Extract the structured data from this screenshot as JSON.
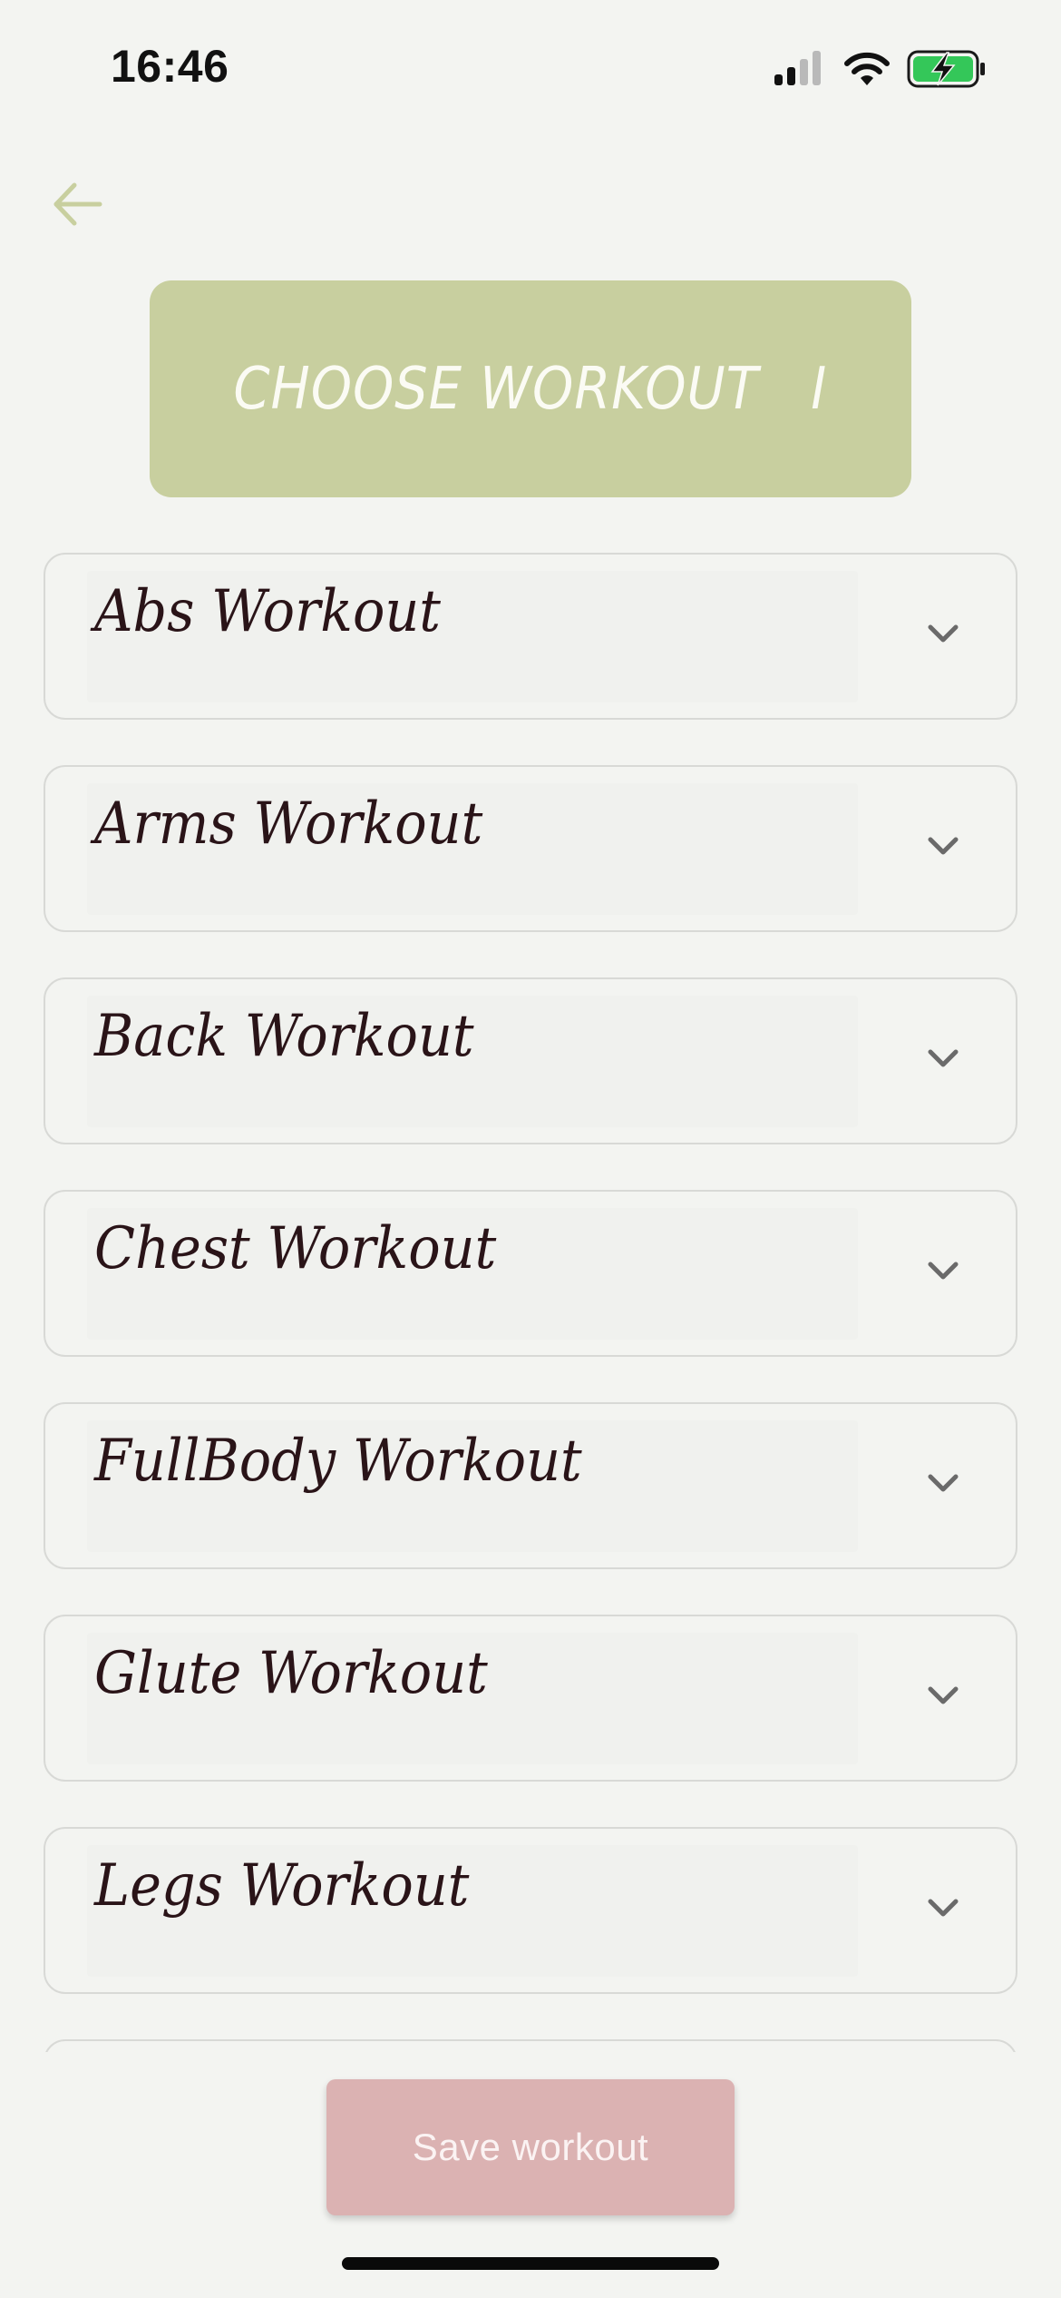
{
  "status_bar": {
    "time": "16:46",
    "icons": [
      "signal-icon",
      "wifi-icon",
      "battery-charging-icon"
    ],
    "battery_color": "#34c759"
  },
  "nav": {
    "back_icon": "arrow-left-icon",
    "back_color": "#c8cf9f"
  },
  "header": {
    "title": "CHOOSE WORKOUT   I",
    "background": "#c8cf9f"
  },
  "workouts": [
    {
      "label": "Abs Workout",
      "icon": "chevron-down-icon"
    },
    {
      "label": "Arms Workout",
      "icon": "chevron-down-icon"
    },
    {
      "label": "Back Workout",
      "icon": "chevron-down-icon"
    },
    {
      "label": "Chest Workout",
      "icon": "chevron-down-icon"
    },
    {
      "label": "FullBody Workout",
      "icon": "chevron-down-icon"
    },
    {
      "label": "Glute Workout",
      "icon": "chevron-down-icon"
    },
    {
      "label": "Legs Workout",
      "icon": "chevron-down-icon"
    }
  ],
  "footer": {
    "save_label": "Save workout",
    "save_color": "#dbb2b2"
  }
}
